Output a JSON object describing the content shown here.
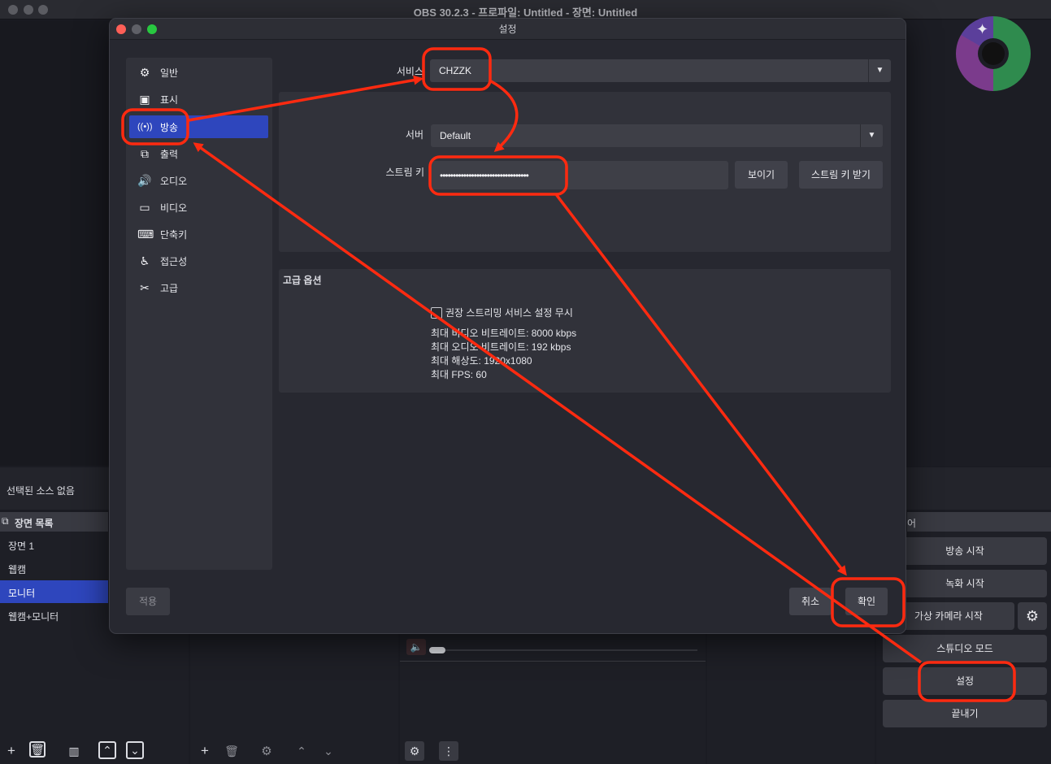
{
  "window": {
    "title": "OBS 30.2.3 - 프로파일: Untitled - 장면: Untitled"
  },
  "source_toolbar": {
    "no_source": "선택된 소스 없음"
  },
  "scenes": {
    "header": "장면 목록",
    "items": [
      {
        "label": "장면 1",
        "active": false
      },
      {
        "label": "웹캠",
        "active": false
      },
      {
        "label": "모니터",
        "active": true
      },
      {
        "label": "웹캠+모니터",
        "active": false
      }
    ]
  },
  "controls": {
    "header_fragment": "어",
    "buttons": [
      "방송 시작",
      "녹화 시작",
      "가상 카메라 시작",
      "스튜디오 모드",
      "설정",
      "끝내기"
    ]
  },
  "dialog": {
    "title": "설정",
    "sidebar": [
      {
        "label": "일반",
        "icon": "gear-icon"
      },
      {
        "label": "표시",
        "icon": "display-icon"
      },
      {
        "label": "방송",
        "icon": "antenna-icon",
        "active": true
      },
      {
        "label": "출력",
        "icon": "output-icon"
      },
      {
        "label": "오디오",
        "icon": "speaker-icon"
      },
      {
        "label": "비디오",
        "icon": "monitor-icon"
      },
      {
        "label": "단축키",
        "icon": "keyboard-icon"
      },
      {
        "label": "접근성",
        "icon": "accessibility-icon"
      },
      {
        "label": "고급",
        "icon": "tools-icon"
      }
    ],
    "service": {
      "label": "서비스",
      "value": "CHZZK"
    },
    "server": {
      "label": "서버",
      "value": "Default"
    },
    "stream_key": {
      "label": "스트림 키",
      "value": "••••••••••••••••••••••••••••••••••",
      "show_button": "보이기",
      "get_key_button": "스트림 키 받기"
    },
    "advanced": {
      "title": "고급 옵션",
      "ignore_checkbox": "권장 스트리밍 서비스 설정 무시",
      "info": [
        "최대 비디오 비트레이트: 8000 kbps",
        "최대 오디오 비트레이트: 192 kbps",
        "최대 해상도: 1920x1080",
        "최대 FPS: 60"
      ]
    },
    "buttons": {
      "apply": "적용",
      "cancel": "취소",
      "ok": "확인"
    }
  },
  "annotation_color": "#ff2a10"
}
